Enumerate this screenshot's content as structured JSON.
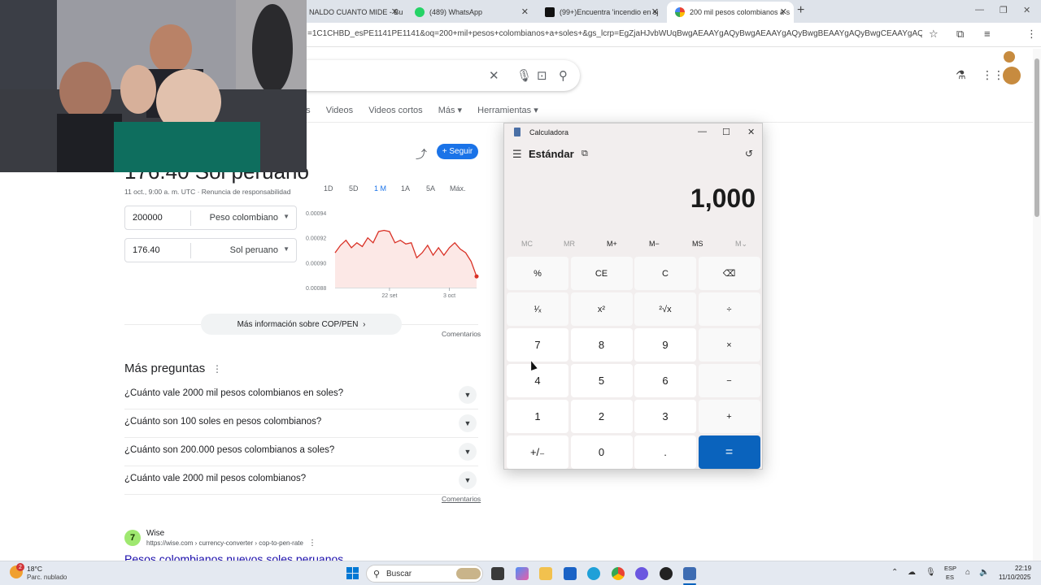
{
  "browser": {
    "tabs": [
      {
        "title": "NALDO CUANTO MIDE - Bu",
        "icon": "youtube-icon"
      },
      {
        "title": "(489) WhatsApp",
        "icon": "whatsapp-icon"
      },
      {
        "title": "(99+)Encuentra 'incendio en sj",
        "icon": "tiktok-icon"
      },
      {
        "title": "200 mil pesos colombianos a s",
        "icon": "google-icon"
      }
    ],
    "url": "=1C1CHBD_esPE1141PE1141&oq=200+mil+pesos+colombianos+a+soles+&gs_lcrp=EgZjaHJvbWUqBwgAEAAYgAQyBwgAEAAYgAQyBwgBEAAYgAQyBwgCEAAYgAQyBwgDEAAYgAQ"
  },
  "google": {
    "nav_tabs": [
      "es",
      "Videos",
      "Videos cortos",
      "Más ▾",
      "Herramientas ▾"
    ],
    "follow_label": "Seguir",
    "big_rate": "176.40 Sol peruano",
    "rate_meta": "11 oct., 9:00 a. m. UTC · Renuncia de responsabilidad",
    "converter": {
      "from_amount": "200000",
      "from_currency": "Peso colombiano",
      "to_amount": "176.40",
      "to_currency": "Sol peruano"
    },
    "ranges": [
      "1D",
      "5D",
      "1 M",
      "1A",
      "5A",
      "Máx."
    ],
    "more_info": "Más información sobre COP/PEN",
    "comments": "Comentarios",
    "more_questions": "Más preguntas",
    "questions": [
      "¿Cuánto vale 2000 mil pesos colombianos en soles?",
      "¿Cuánto son 100 soles en pesos colombianos?",
      "¿Cuánto son 200.000 pesos colombianos a soles?",
      "¿Cuánto vale 2000 mil pesos colombianos?"
    ],
    "result": {
      "site": "Wise",
      "url": "https://wise.com › currency-converter › cop-to-pen-rate",
      "title": "Pesos colombianos nuevos soles peruanos"
    }
  },
  "chart_data": {
    "type": "line",
    "title": "",
    "xlabel": "",
    "ylabel": "",
    "x_ticks": [
      "22 set",
      "3 oct"
    ],
    "y_ticks": [
      "0.00094",
      "0.00092",
      "0.00090",
      "0.00088"
    ],
    "ylim": [
      0.00088,
      0.00094
    ],
    "series": [
      {
        "color": "#d93025",
        "values": [
          0.000908,
          0.000914,
          0.000918,
          0.000912,
          0.000916,
          0.000913,
          0.00092,
          0.000916,
          0.000925,
          0.000926,
          0.000925,
          0.000916,
          0.000918,
          0.000915,
          0.000916,
          0.000904,
          0.000908,
          0.000914,
          0.000906,
          0.000912,
          0.000906,
          0.000912,
          0.000916,
          0.000911,
          0.000908,
          0.000901,
          0.000889
        ]
      }
    ]
  },
  "calculator": {
    "title": "Calculadora",
    "mode": "Estándar",
    "display": "1,000",
    "memory": [
      "MC",
      "MR",
      "M+",
      "M−",
      "MS",
      "M⌄"
    ],
    "keys": [
      [
        "%",
        "CE",
        "C",
        "⌫"
      ],
      [
        "¹⁄ₓ",
        "x²",
        "²√x",
        "÷"
      ],
      [
        "7",
        "8",
        "9",
        "×"
      ],
      [
        "4",
        "5",
        "6",
        "−"
      ],
      [
        "1",
        "2",
        "3",
        "+"
      ],
      [
        "+/₋",
        "0",
        ".",
        "="
      ]
    ]
  },
  "taskbar": {
    "temperature": "18°C",
    "weather": "Parc. nublado",
    "weather_badge": "2",
    "search_label": "Buscar",
    "lang1": "ESP",
    "lang2": "ES",
    "time": "22:19",
    "date": "11/10/2025"
  }
}
